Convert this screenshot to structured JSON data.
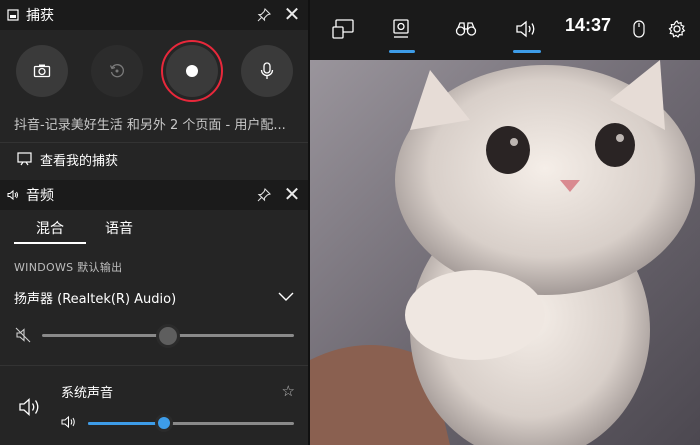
{
  "capture": {
    "title": "捕获",
    "source_text": "抖音-记录美好生活 和另外 2 个页面 - 用户配...",
    "view_captures_label": "查看我的捕获"
  },
  "audio": {
    "title": "音频",
    "tabs": [
      {
        "label": "混合",
        "active": true
      },
      {
        "label": "语音",
        "active": false
      }
    ],
    "section_label": "WINDOWS 默认输出",
    "device": "扬声器 (Realtek(R) Audio)",
    "master_volume_fraction": 0.5,
    "app_name": "系统声音",
    "app_volume_fraction": 0.37
  },
  "topbar": {
    "time": "14:37"
  },
  "colors": {
    "accent": "#3d9ce8",
    "record_ring": "#e8283b"
  }
}
